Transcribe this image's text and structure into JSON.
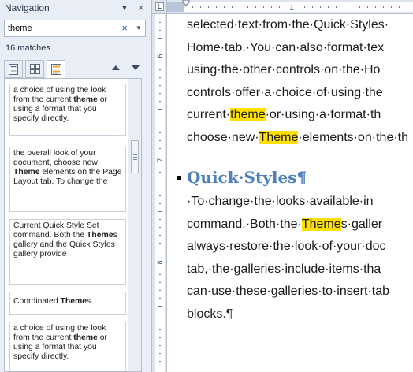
{
  "nav": {
    "title": "Navigation",
    "menu_glyph": "▼",
    "close_glyph": "×",
    "search": {
      "value": "theme",
      "clear_glyph": "×",
      "dropdown_glyph": "▼"
    },
    "match_count": "16 matches",
    "view_tabs": [
      {
        "icon": "headings-view-icon",
        "active": false
      },
      {
        "icon": "pages-view-icon",
        "active": false
      },
      {
        "icon": "results-view-icon",
        "active": true
      }
    ],
    "results": [
      {
        "pre": "a choice of using the look from the current ",
        "bold": "theme",
        "post": " or using a format that you specify directly."
      },
      {
        "pre": "the overall look of your document, choose new ",
        "bold": "Theme",
        "post": " elements on the Page Layout tab. To change the"
      },
      {
        "pre": "Current Quick Style Set command. Both the ",
        "bold": "Theme",
        "post": "s gallery and the Quick Styles gallery provide"
      },
      {
        "pre": "Coordinated ",
        "bold": "Theme",
        "post": "s"
      },
      {
        "pre": "a choice of using the look from the current ",
        "bold": "theme",
        "post": " or using a format that you specify directly."
      }
    ]
  },
  "ruler": {
    "corner_glyph": "L",
    "h_numbers": [
      "1"
    ],
    "v_numbers": [
      "6",
      "7",
      "8"
    ]
  },
  "document": {
    "lines": [
      {
        "segments": [
          {
            "t": "selected·text·from·the·Quick·Styles·",
            "hl": false
          }
        ]
      },
      {
        "segments": [
          {
            "t": "Home·tab.·You·can·also·format·tex",
            "hl": false
          }
        ]
      },
      {
        "segments": [
          {
            "t": "using·the·other·controls·on·the·Ho",
            "hl": false
          }
        ]
      },
      {
        "segments": [
          {
            "t": "controls·offer·a·choice·of·using·the",
            "hl": false
          }
        ]
      },
      {
        "segments": [
          {
            "t": "current·",
            "hl": false
          },
          {
            "t": "theme",
            "hl": true
          },
          {
            "t": "·or·using·a·format·th",
            "hl": false
          }
        ]
      },
      {
        "segments": [
          {
            "t": "choose·new·",
            "hl": false
          },
          {
            "t": "Theme",
            "hl": true
          },
          {
            "t": "·elements·on·the·th",
            "hl": false
          }
        ]
      }
    ],
    "heading": "Quick·Styles¶",
    "lines2": [
      {
        "segments": [
          {
            "t": "    ·To·change·the·looks·available·in",
            "hl": false
          }
        ]
      },
      {
        "segments": [
          {
            "t": "command.·Both·the·",
            "hl": false
          },
          {
            "t": "Theme",
            "hl": true
          },
          {
            "t": "s·galler",
            "hl": false
          }
        ]
      },
      {
        "segments": [
          {
            "t": "always·restore·the·look·of·your·doc",
            "hl": false
          }
        ]
      },
      {
        "segments": [
          {
            "t": "tab,·the·galleries·include·items·tha",
            "hl": false
          }
        ]
      },
      {
        "segments": [
          {
            "t": "can·use·these·galleries·to·insert·tab",
            "hl": false
          }
        ]
      },
      {
        "segments": [
          {
            "t": "blocks.¶",
            "hl": false
          }
        ]
      }
    ]
  },
  "colors": {
    "highlight": "#ffe000",
    "heading": "#4f81bd",
    "pane_bg": "#e9eef6"
  }
}
